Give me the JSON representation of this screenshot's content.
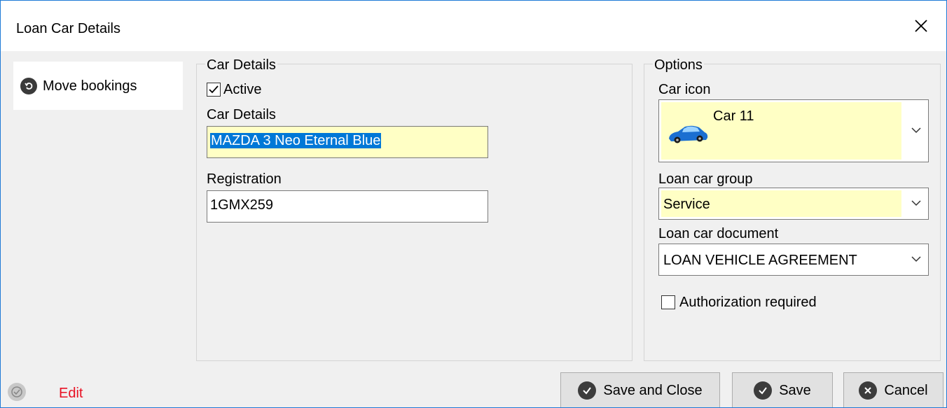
{
  "window": {
    "title": "Loan Car Details"
  },
  "side_menu": {
    "items": [
      {
        "label": "Move bookings",
        "icon": "undo-circle-icon"
      }
    ]
  },
  "car_details": {
    "group_label": "Car Details",
    "active": {
      "label": "Active",
      "checked": true
    },
    "details": {
      "label": "Car Details",
      "value": "MAZDA 3 Neo Eternal Blue"
    },
    "registration": {
      "label": "Registration",
      "value": "1GMX259"
    }
  },
  "options": {
    "group_label": "Options",
    "car_icon": {
      "label": "Car icon",
      "value": "Car 11",
      "icon": "blue-car-icon"
    },
    "loan_car_group": {
      "label": "Loan car group",
      "value": "Service"
    },
    "loan_car_document": {
      "label": "Loan car document",
      "value": "LOAN VEHICLE AGREEMENT"
    },
    "authorization": {
      "label": "Authorization required",
      "checked": false
    }
  },
  "footer": {
    "status_text": "Edit",
    "buttons": {
      "save_close": "Save and Close",
      "save": "Save",
      "cancel": "Cancel"
    }
  },
  "colors": {
    "accent_border": "#1e7ad6",
    "highlight_field": "#ffffc5",
    "selection": "#0078d7",
    "edit_text": "#e81123"
  }
}
